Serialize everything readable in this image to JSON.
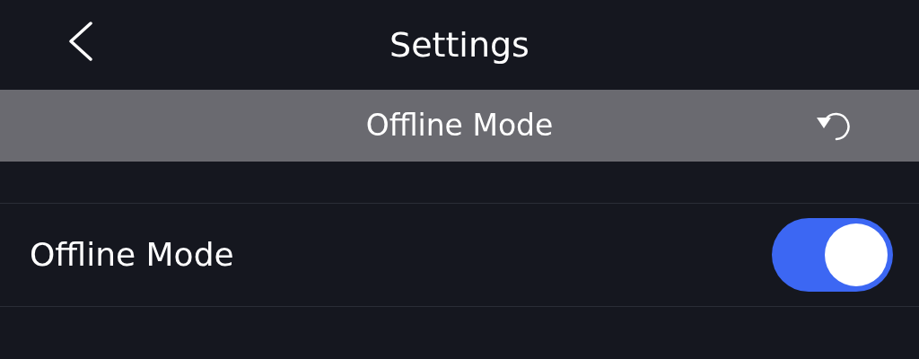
{
  "nav_bar": {
    "title": "Settings"
  },
  "section_header": {
    "title": "Offline Mode"
  },
  "settings_rows": [
    {
      "kind": "toggle",
      "label": "Offline Mode",
      "on": true
    }
  ]
}
